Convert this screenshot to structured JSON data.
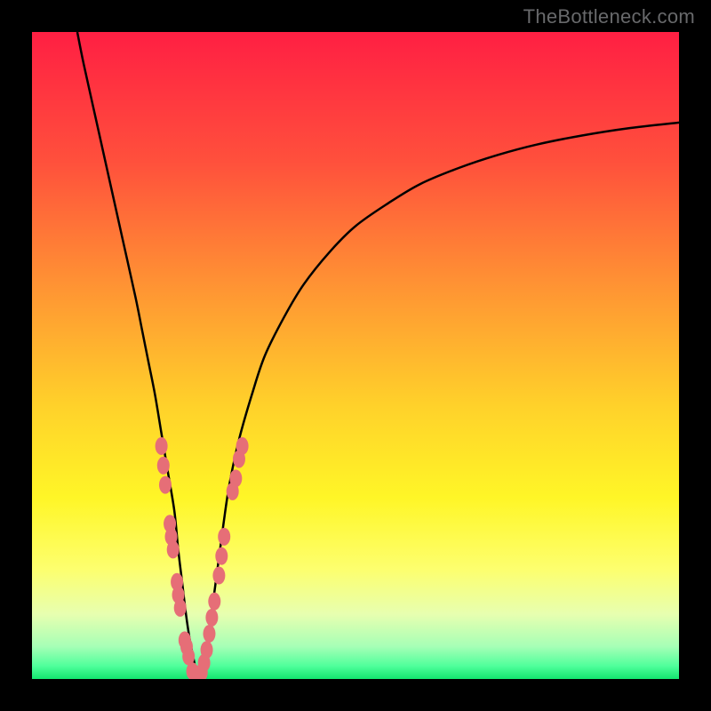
{
  "watermark": "TheBottleneck.com",
  "colors": {
    "frame": "#000000",
    "gradient_stops": [
      {
        "offset": 0.0,
        "color": "#ff1f43"
      },
      {
        "offset": 0.2,
        "color": "#ff503c"
      },
      {
        "offset": 0.4,
        "color": "#ff9633"
      },
      {
        "offset": 0.58,
        "color": "#ffd22a"
      },
      {
        "offset": 0.72,
        "color": "#fff627"
      },
      {
        "offset": 0.83,
        "color": "#fdff6e"
      },
      {
        "offset": 0.9,
        "color": "#e7ffb0"
      },
      {
        "offset": 0.95,
        "color": "#a6ffb6"
      },
      {
        "offset": 0.98,
        "color": "#4fff9b"
      },
      {
        "offset": 1.0,
        "color": "#13e56e"
      }
    ],
    "curve": "#000000",
    "dots": "#e66e77"
  },
  "chart_data": {
    "type": "line",
    "title": "",
    "xlabel": "",
    "ylabel": "",
    "xlim": [
      0,
      100
    ],
    "ylim": [
      0,
      100
    ],
    "series": [
      {
        "name": "bottleneck-curve",
        "x": [
          7,
          8,
          10,
          12,
          14,
          16,
          17,
          18,
          19,
          20,
          21,
          22,
          22.6,
          23.2,
          23.8,
          24.4,
          25,
          25.4,
          25.8,
          26.2,
          26.7,
          27.3,
          28,
          28.8,
          29.6,
          30.5,
          32,
          34,
          36,
          39,
          42,
          46,
          50,
          55,
          60,
          66,
          72,
          78,
          85,
          92,
          100
        ],
        "y": [
          100,
          95,
          86,
          77,
          68,
          59,
          54,
          49,
          44,
          38,
          32,
          26,
          20,
          15,
          10,
          6,
          3,
          1,
          0,
          1,
          3,
          7,
          12,
          18,
          24,
          30,
          37,
          44,
          50,
          56,
          61,
          66,
          70,
          73.5,
          76.5,
          79,
          81,
          82.6,
          84,
          85.1,
          86
        ]
      }
    ],
    "dot_clusters": [
      {
        "name": "left-cluster",
        "points": [
          {
            "x": 20,
            "y": 36
          },
          {
            "x": 20.3,
            "y": 33
          },
          {
            "x": 20.6,
            "y": 30
          },
          {
            "x": 21.3,
            "y": 24
          },
          {
            "x": 21.5,
            "y": 22
          },
          {
            "x": 21.8,
            "y": 20
          },
          {
            "x": 22.4,
            "y": 15
          },
          {
            "x": 22.6,
            "y": 13
          },
          {
            "x": 22.9,
            "y": 11
          },
          {
            "x": 23.6,
            "y": 6
          },
          {
            "x": 23.9,
            "y": 5
          },
          {
            "x": 24.2,
            "y": 3.5
          },
          {
            "x": 24.8,
            "y": 1.2
          },
          {
            "x": 25.2,
            "y": 0.7
          },
          {
            "x": 25.7,
            "y": 0.6
          }
        ]
      },
      {
        "name": "right-cluster",
        "points": [
          {
            "x": 26.2,
            "y": 1
          },
          {
            "x": 26.6,
            "y": 2.5
          },
          {
            "x": 27,
            "y": 4.5
          },
          {
            "x": 27.4,
            "y": 7
          },
          {
            "x": 27.8,
            "y": 9.5
          },
          {
            "x": 28.2,
            "y": 12
          },
          {
            "x": 28.9,
            "y": 16
          },
          {
            "x": 29.3,
            "y": 19
          },
          {
            "x": 29.7,
            "y": 22
          },
          {
            "x": 31,
            "y": 29
          },
          {
            "x": 31.5,
            "y": 31
          },
          {
            "x": 32,
            "y": 34
          },
          {
            "x": 32.5,
            "y": 36
          }
        ]
      }
    ]
  }
}
